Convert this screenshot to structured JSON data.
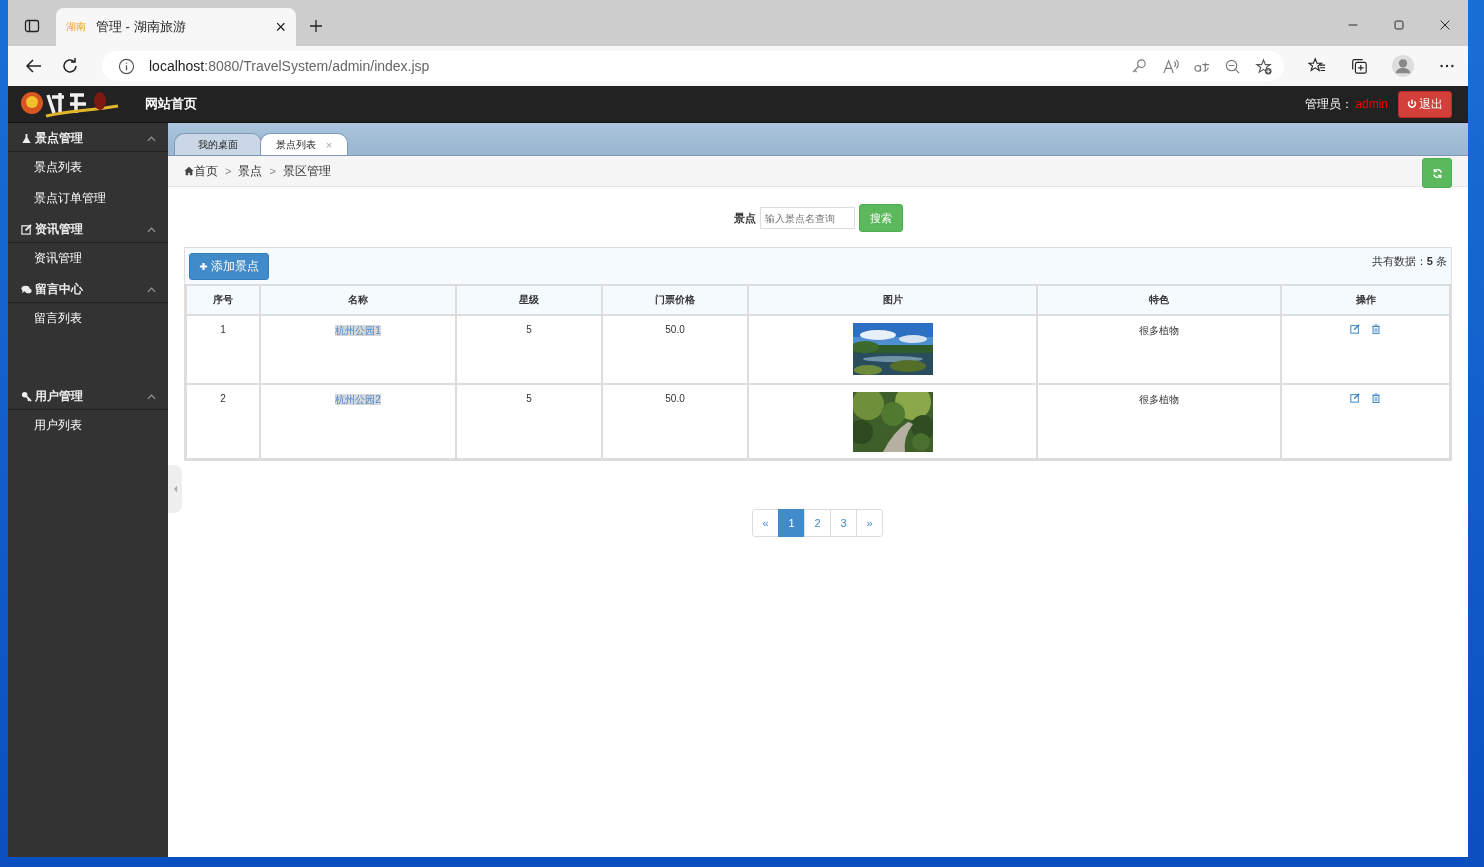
{
  "browser": {
    "tab": {
      "favicon": "湖南",
      "title": "管理 - 湖南旅游",
      "close": "×"
    },
    "url": {
      "host": "localhost",
      "path": ":8080/TravelSystem/admin/index.jsp"
    }
  },
  "header": {
    "title": "网站首页",
    "admin_label": "管理员：",
    "admin_name": "admin",
    "logout": "退出"
  },
  "sidebar": [
    {
      "title": "景点管理",
      "expanded": true,
      "items": [
        {
          "label": "景点列表"
        },
        {
          "label": "景点订单管理"
        }
      ]
    },
    {
      "title": "资讯管理",
      "expanded": true,
      "items": [
        {
          "label": "资讯管理"
        }
      ]
    },
    {
      "title": "留言中心",
      "expanded": true,
      "items": [
        {
          "label": "留言列表"
        }
      ]
    },
    {
      "title": "用户管理",
      "expanded": true,
      "items": [
        {
          "label": "用户列表"
        }
      ]
    }
  ],
  "tabs": [
    {
      "label": "我的桌面",
      "selected": false
    },
    {
      "label": "景点列表",
      "selected": true,
      "close": "×"
    }
  ],
  "breadcrumb": {
    "items": [
      "首页",
      "景点",
      "景区管理"
    ],
    "separator": ">"
  },
  "search": {
    "label": "景点",
    "placeholder": "输入景点名查询",
    "button": "搜索"
  },
  "toolbar": {
    "add_button": "添加景点",
    "count": "共有数据：**5** 条"
  },
  "table": {
    "columns": [
      "序号",
      "名称",
      "星级",
      "门票价格",
      "图片",
      "特色",
      "操作"
    ],
    "rows": [
      {
        "no": "1",
        "name": "杭州公园1",
        "stars": "5",
        "price": "50.0",
        "feature": "很多植物"
      },
      {
        "no": "2",
        "name": "杭州公园2",
        "stars": "5",
        "price": "50.0",
        "feature": "很多植物"
      }
    ]
  },
  "pagination": {
    "prev": "«",
    "pages": [
      {
        "label": "1",
        "selected": true
      },
      {
        "label": "2",
        "selected": false
      },
      {
        "label": "3",
        "selected": false
      }
    ],
    "next": "»"
  }
}
